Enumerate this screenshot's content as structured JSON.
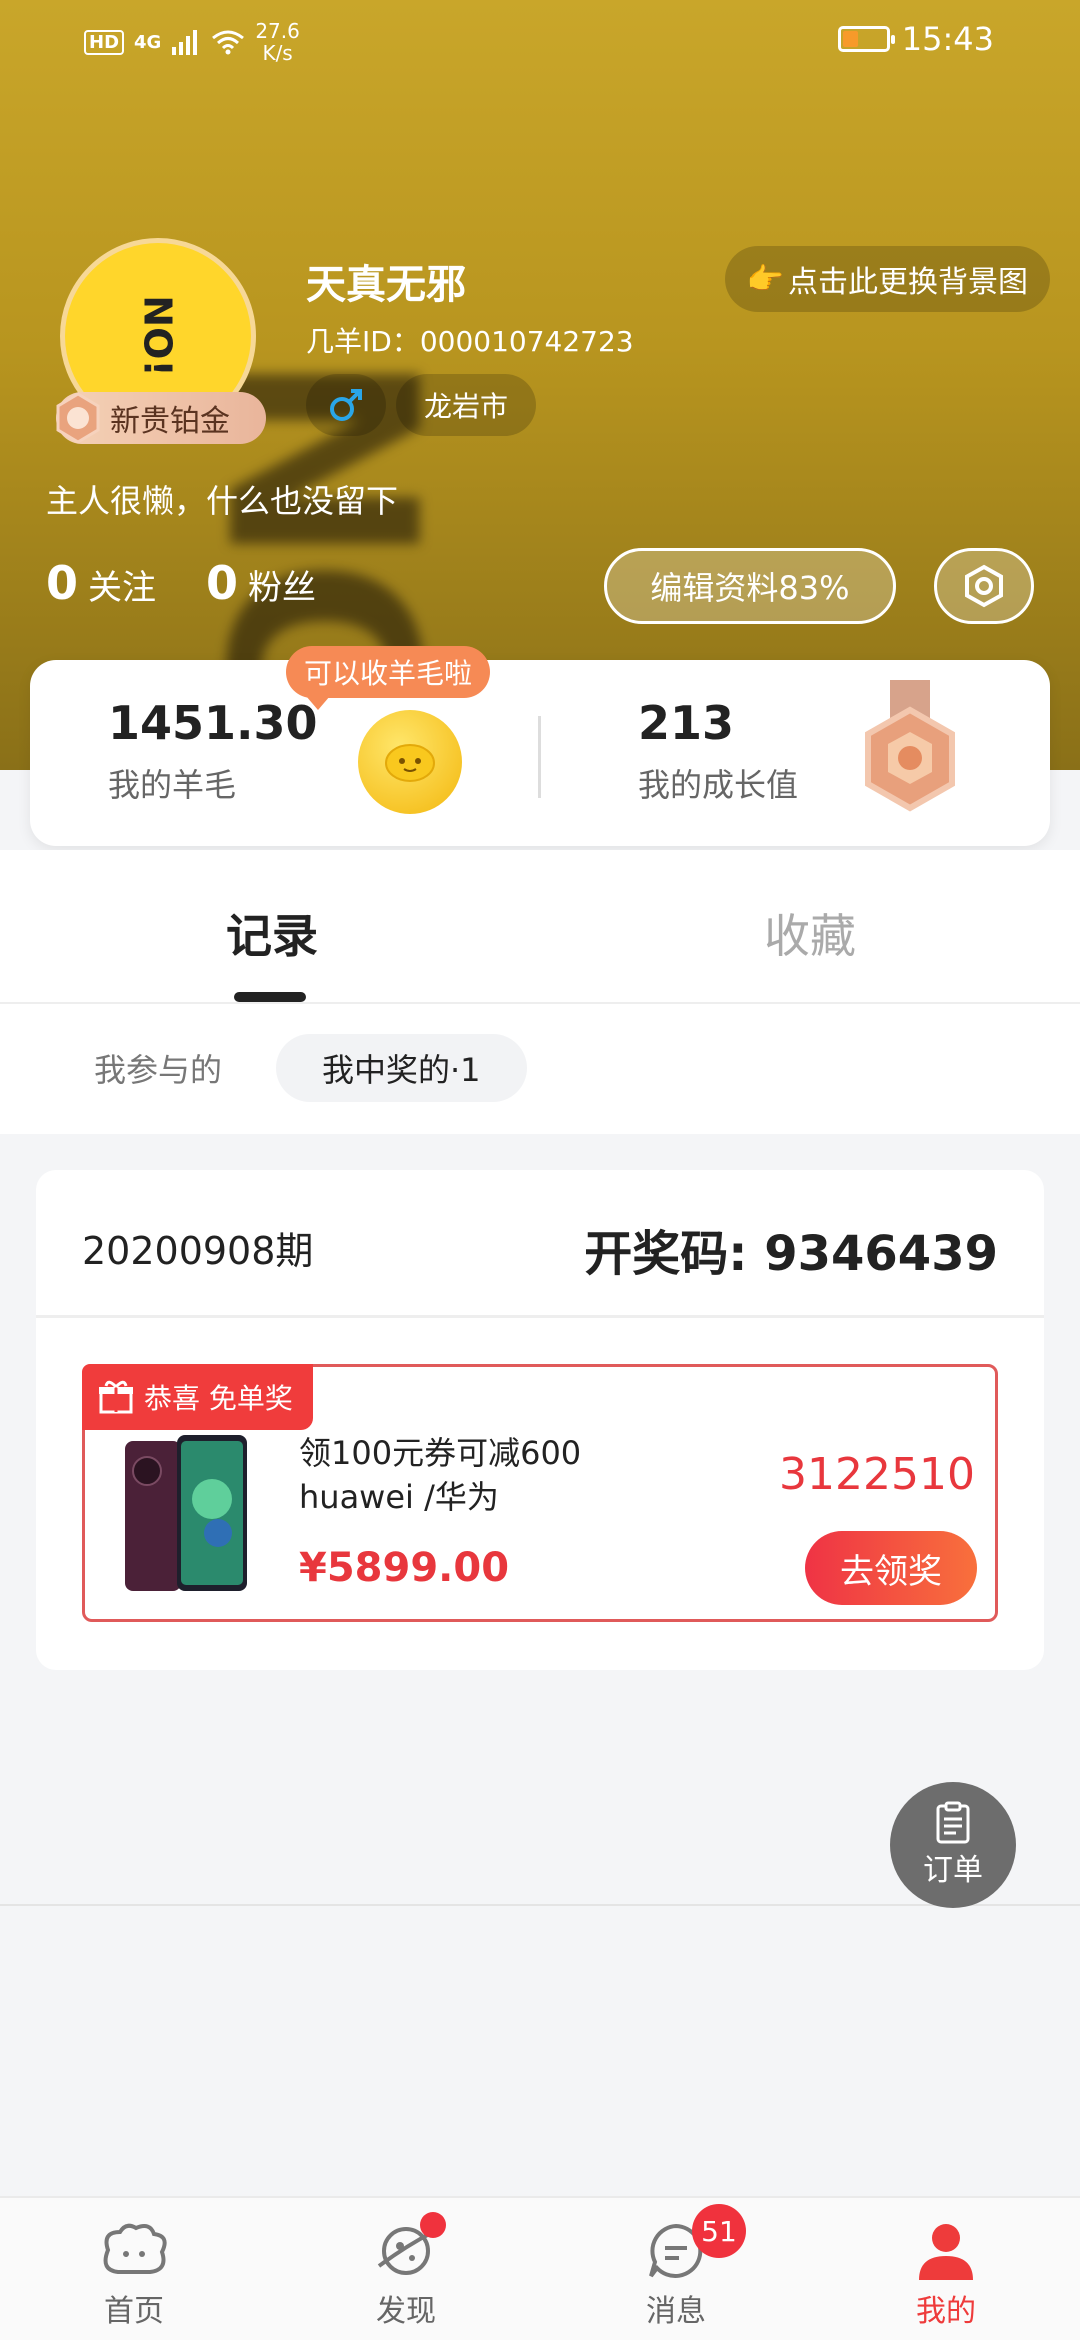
{
  "status_bar": {
    "network_label": "HD",
    "signal_label": "4G",
    "speed_value": "27.6",
    "speed_unit": "K/s",
    "time": "15:43",
    "battery_level": 0.35,
    "battery_color": "#f79a2a"
  },
  "header": {
    "background_text": "NO!",
    "avatar_text": "NO!",
    "rank_label": "新贵铂金",
    "username": "天真无邪",
    "user_id_label": "几羊ID：",
    "user_id": "000010742723",
    "gender_icon": "male-icon",
    "city": "龙岩市",
    "change_bg_label": "点击此更换背景图",
    "change_bg_icon": "👉",
    "bio": "主人很懒，什么也没留下",
    "following_count": "0",
    "following_label": "关注",
    "fans_count": "0",
    "fans_label": "粉丝",
    "edit_label": "编辑资料83%"
  },
  "stats": {
    "wool_value": "1451.30",
    "wool_label": "我的羊毛",
    "tooltip": "可以收羊毛啦",
    "growth_value": "213",
    "growth_label": "我的成长值"
  },
  "tabs": [
    {
      "label": "记录",
      "active": true
    },
    {
      "label": "收藏",
      "active": false
    }
  ],
  "subtabs": [
    {
      "label": "我参与的",
      "selected": false
    },
    {
      "label": "我中奖的·1",
      "selected": true
    }
  ],
  "record": {
    "period": "20200908期",
    "lottery_label": "开奖码: 9346439",
    "tag_label": "恭喜 免单奖",
    "product_title": "领100元券可减600 huawei /华为",
    "price": "¥5899.00",
    "code": "3122510",
    "claim_label": "去领奖"
  },
  "fab": {
    "label": "订单"
  },
  "bottom_nav": [
    {
      "label": "首页",
      "icon": "sheep-home-icon",
      "active": false
    },
    {
      "label": "发现",
      "icon": "discover-planet-icon",
      "active": false,
      "dot": true
    },
    {
      "label": "消息",
      "icon": "message-icon",
      "active": false,
      "badge": "51"
    },
    {
      "label": "我的",
      "icon": "profile-icon",
      "active": true
    }
  ],
  "colors": {
    "accent_red": "#e8373d",
    "header_gold": "#c9a62a",
    "tooltip_orange": "#f68a55"
  }
}
